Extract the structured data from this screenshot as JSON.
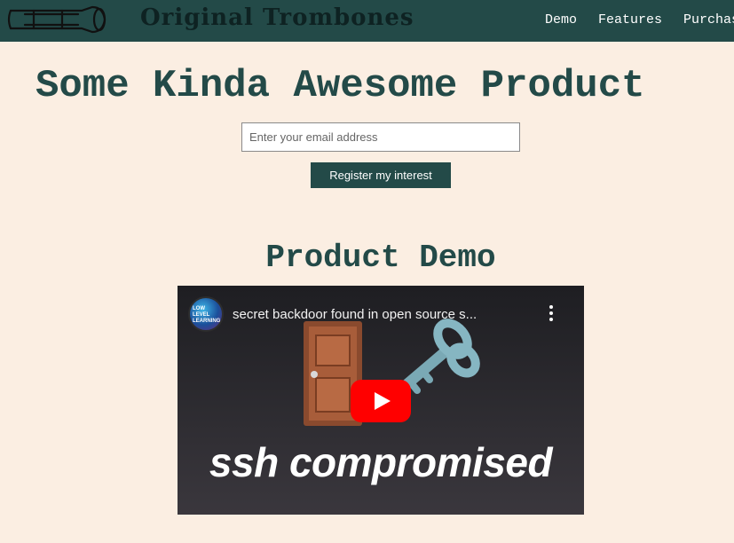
{
  "header": {
    "brand": "Original Trombones",
    "nav": [
      "Demo",
      "Features",
      "Purchase"
    ]
  },
  "hero": {
    "title": "Some Kinda Awesome Product",
    "email_placeholder": "Enter your email address",
    "email_value": "",
    "register_label": "Register my interest"
  },
  "demo": {
    "section_title": "Product Demo",
    "video": {
      "channel_label": "LOW LEVEL LEARNING",
      "title": "secret backdoor found in open source s...",
      "caption": "ssh compromised",
      "thumbnail_icons": [
        "door-icon",
        "key-icon",
        "play-button-icon"
      ]
    }
  },
  "colors": {
    "header_bg": "#234a48",
    "page_bg": "#fbeee2",
    "accent": "#234a48",
    "play_red": "#ff0000"
  }
}
